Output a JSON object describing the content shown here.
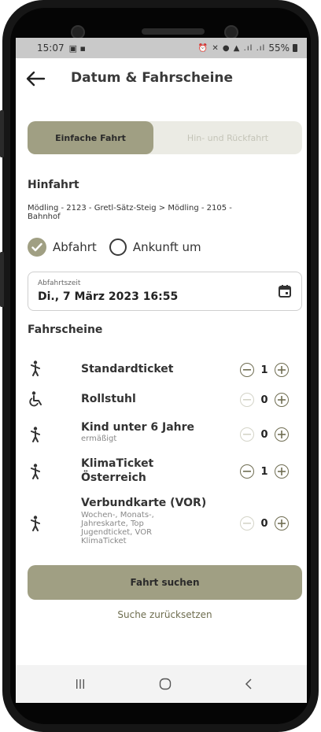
{
  "status": {
    "time": "15:07",
    "battery": "55%"
  },
  "header": {
    "title": "Datum & Fahrscheine"
  },
  "trip_type": {
    "options": [
      "Einfache Fahrt",
      "Hin- und Rückfahrt"
    ]
  },
  "outbound": {
    "heading": "Hinfahrt",
    "route": "Mödling - 2123 - Gretl-Sätz-Steig > Mödling - 2105 - Bahnhof"
  },
  "time_mode": {
    "departure_label": "Abfahrt",
    "arrival_label": "Ankunft um"
  },
  "datetime": {
    "label": "Abfahrtszeit",
    "value": "Di., 7 März 2023 16:55"
  },
  "tickets": {
    "heading": "Fahrscheine",
    "items": [
      {
        "name": "Standardticket",
        "subtitle": "",
        "count": "1"
      },
      {
        "name": "Rollstuhl",
        "subtitle": "",
        "count": "0"
      },
      {
        "name": "Kind unter 6 Jahre",
        "subtitle": "ermäßigt",
        "count": "0"
      },
      {
        "name": "KlimaTicket\nÖsterreich",
        "subtitle": "",
        "count": "1"
      },
      {
        "name": "Verbundkarte (VOR)",
        "subtitle": "Wochen-, Monats-,\nJahreskarte, Top\nJugendticket, VOR\nKlimaTicket",
        "count": "0"
      }
    ]
  },
  "actions": {
    "search": "Fahrt suchen",
    "reset": "Suche zurücksetzen"
  },
  "colors": {
    "accent": "#a09f83",
    "accent_dark": "#6f6d52",
    "segment_bg": "#ebebe4"
  },
  "icons": [
    "back-arrow-icon",
    "calendar-icon",
    "pedestrian-icon",
    "wheelchair-icon",
    "minus-circle-icon",
    "plus-circle-icon",
    "check-circle-icon"
  ]
}
